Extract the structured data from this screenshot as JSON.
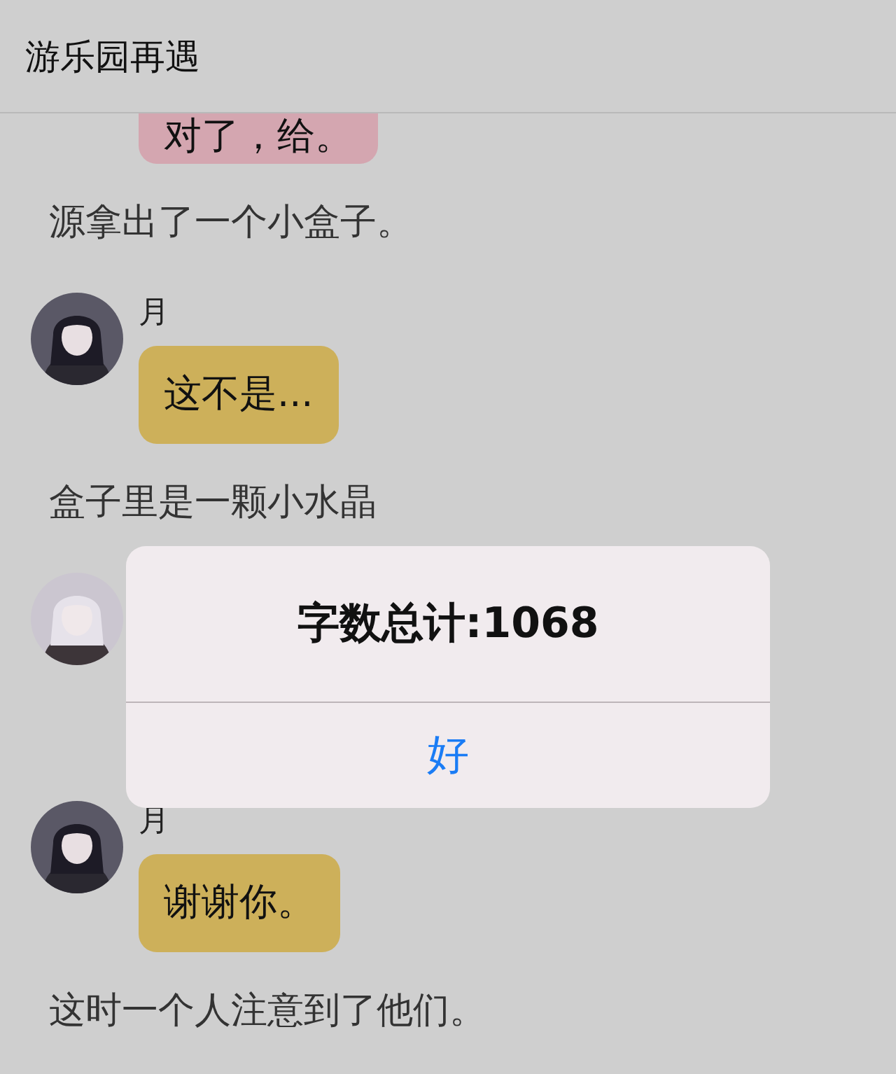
{
  "header": {
    "title": "游乐园再遇"
  },
  "messages": [
    {
      "kind": "speech",
      "text": "对了，给。",
      "color": "#d4a6b0"
    },
    {
      "kind": "narration",
      "text": "源拿出了一个小盒子。"
    },
    {
      "kind": "speech",
      "avatar": {
        "kind": "dark"
      },
      "name": "月",
      "text": "这不是...",
      "color": "#cdb05a"
    },
    {
      "kind": "narration",
      "text": "盒子里是一颗小水晶"
    },
    {
      "kind": "speech",
      "avatar": {
        "kind": "light"
      }
    },
    {
      "kind": "speech",
      "avatar": {
        "kind": "dark"
      },
      "name": "月",
      "text": "谢谢你。",
      "color": "#cdb05a"
    },
    {
      "kind": "narration",
      "text": "这时一个人注意到了他们。"
    }
  ],
  "alert": {
    "title": "字数总计:1068",
    "button": "好"
  }
}
